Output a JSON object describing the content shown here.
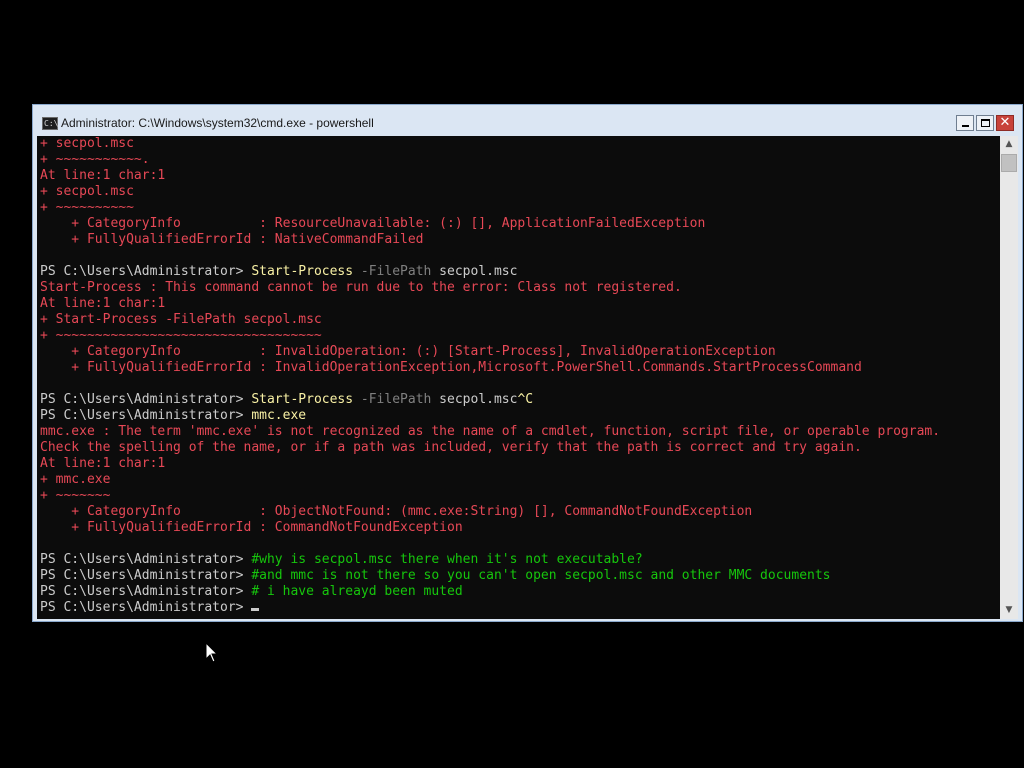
{
  "window": {
    "title": "Administrator: C:\\Windows\\system32\\cmd.exe - powershell",
    "icon": "cmd-icon",
    "controls": {
      "minimize": "minimize-icon",
      "maximize": "maximize-icon",
      "close": "close-icon",
      "close_glyph": "✕"
    }
  },
  "icons": {
    "cmd_chevron": "C:\\",
    "scroll_up": "▲",
    "scroll_down": "▼"
  },
  "colors": {
    "console_bg": "#0c0c0c",
    "error_text": "#e74856",
    "normal_text": "#cccccc",
    "command_text": "#f9f1a5",
    "parameter_text": "#808080",
    "comment_text": "#16c60c",
    "titlebar_bg": "#dbe6f3",
    "close_button": "#c8423a"
  },
  "console": {
    "lines": [
      {
        "type": "error",
        "text": "+ secpol.msc"
      },
      {
        "type": "error",
        "text": "+ ~~~~~~~~~~~."
      },
      {
        "type": "error",
        "text": "At line:1 char:1"
      },
      {
        "type": "error",
        "text": "+ secpol.msc"
      },
      {
        "type": "error",
        "text": "+ ~~~~~~~~~~"
      },
      {
        "type": "error",
        "text": "    + CategoryInfo          : ResourceUnavailable: (:) [], ApplicationFailedException"
      },
      {
        "type": "error",
        "text": "    + FullyQualifiedErrorId : NativeCommandFailed"
      },
      {
        "type": "blank",
        "text": ""
      },
      {
        "type": "prompt",
        "prompt": "PS C:\\Users\\Administrator> ",
        "command": "Start-Process",
        "param": " -FilePath",
        "arg": " secpol.msc",
        "trail": ""
      },
      {
        "type": "error",
        "text": "Start-Process : This command cannot be run due to the error: Class not registered."
      },
      {
        "type": "error",
        "text": "At line:1 char:1"
      },
      {
        "type": "error",
        "text": "+ Start-Process -FilePath secpol.msc"
      },
      {
        "type": "error",
        "text": "+ ~~~~~~~~~~~~~~~~~~~~~~~~~~~~~~~~~~"
      },
      {
        "type": "error",
        "text": "    + CategoryInfo          : InvalidOperation: (:) [Start-Process], InvalidOperationException"
      },
      {
        "type": "error",
        "text": "    + FullyQualifiedErrorId : InvalidOperationException,Microsoft.PowerShell.Commands.StartProcessCommand"
      },
      {
        "type": "blank",
        "text": ""
      },
      {
        "type": "prompt",
        "prompt": "PS C:\\Users\\Administrator> ",
        "command": "Start-Process",
        "param": " -FilePath",
        "arg": " secpol.msc",
        "trail": "^C"
      },
      {
        "type": "prompt",
        "prompt": "PS C:\\Users\\Administrator> ",
        "command": "mmc.exe",
        "param": "",
        "arg": "",
        "trail": ""
      },
      {
        "type": "error",
        "text": "mmc.exe : The term 'mmc.exe' is not recognized as the name of a cmdlet, function, script file, or operable program."
      },
      {
        "type": "error",
        "text": "Check the spelling of the name, or if a path was included, verify that the path is correct and try again."
      },
      {
        "type": "error",
        "text": "At line:1 char:1"
      },
      {
        "type": "error",
        "text": "+ mmc.exe"
      },
      {
        "type": "error",
        "text": "+ ~~~~~~~"
      },
      {
        "type": "error",
        "text": "    + CategoryInfo          : ObjectNotFound: (mmc.exe:String) [], CommandNotFoundException"
      },
      {
        "type": "error",
        "text": "    + FullyQualifiedErrorId : CommandNotFoundException"
      },
      {
        "type": "blank",
        "text": ""
      },
      {
        "type": "comment",
        "prompt": "PS C:\\Users\\Administrator> ",
        "text": "#why is secpol.msc there when it's not executable?"
      },
      {
        "type": "comment",
        "prompt": "PS C:\\Users\\Administrator> ",
        "text": "#and mmc is not there so you can't open secpol.msc and other MMC documents"
      },
      {
        "type": "comment",
        "prompt": "PS C:\\Users\\Administrator> ",
        "text": "# i have alreayd been muted"
      },
      {
        "type": "active",
        "prompt": "PS C:\\Users\\Administrator> ",
        "text": ""
      }
    ]
  }
}
